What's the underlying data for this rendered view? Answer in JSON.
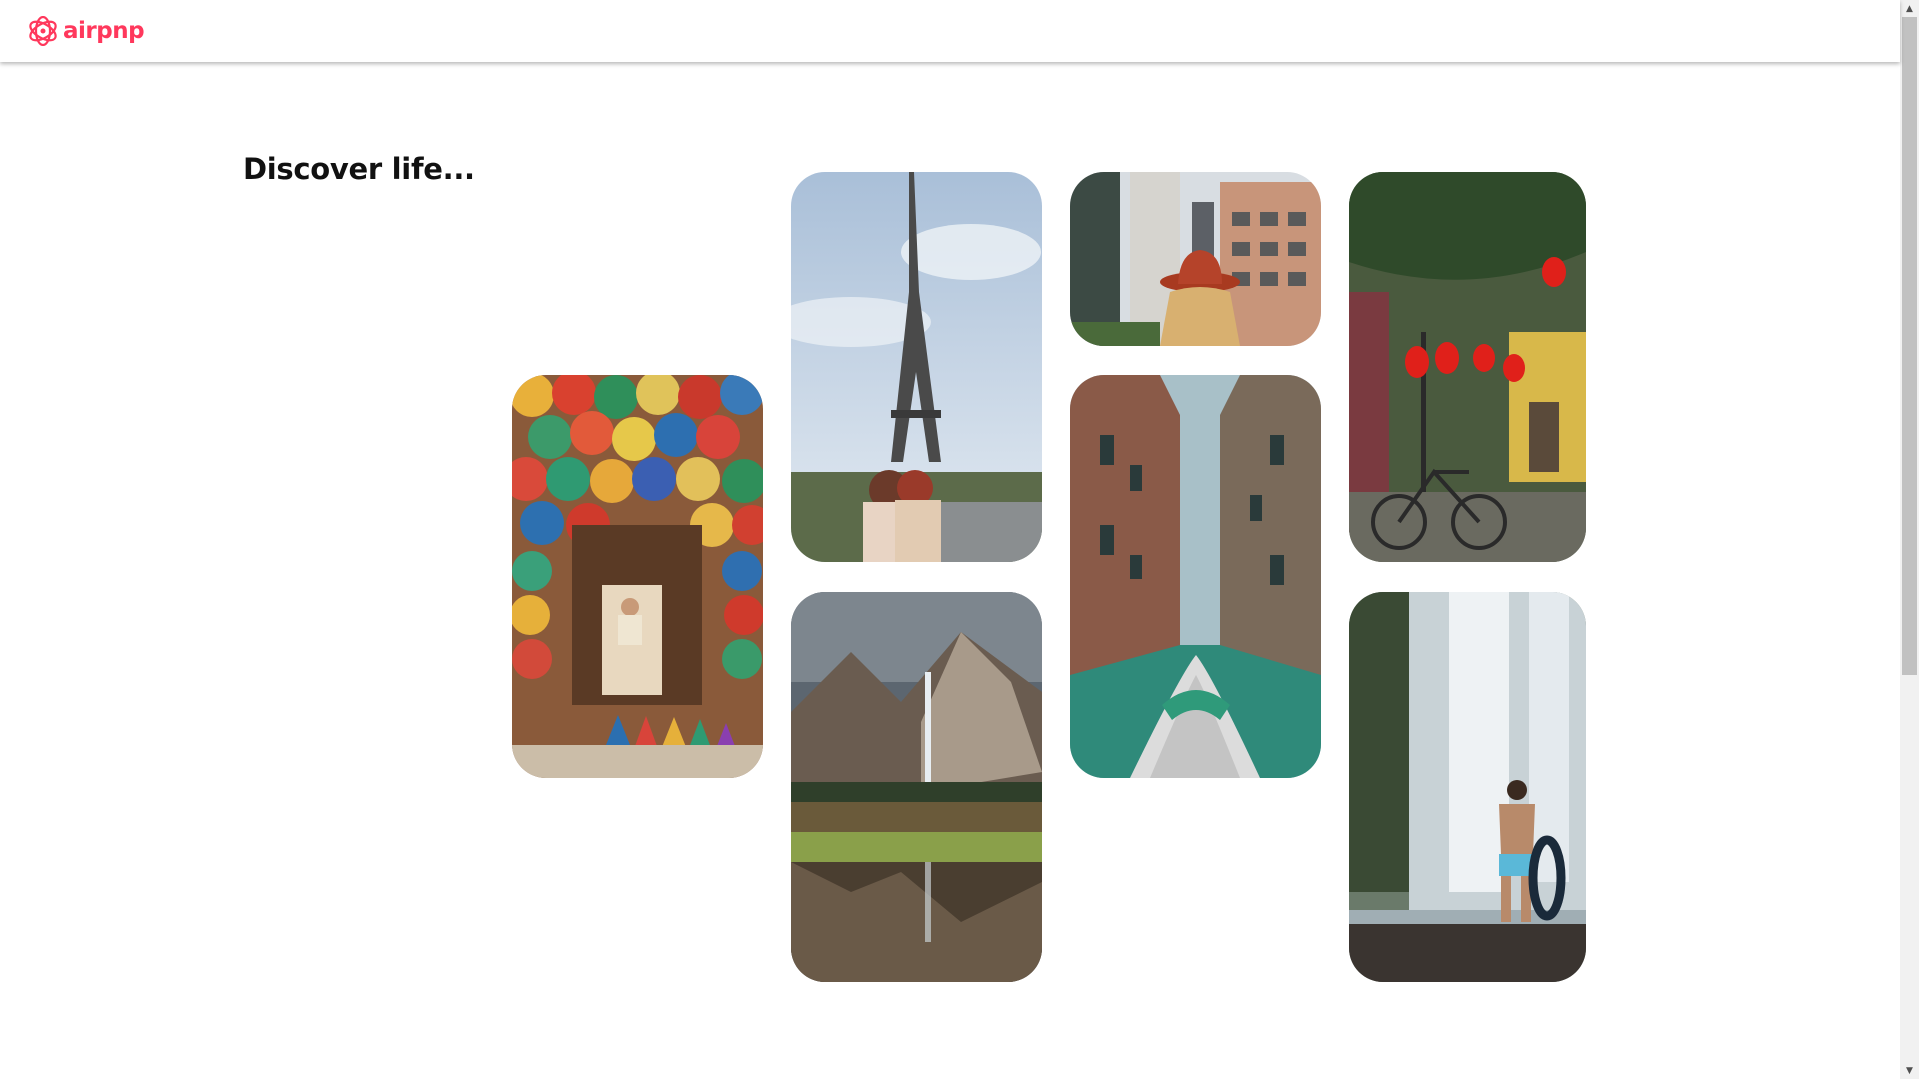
{
  "app": {
    "brand": "airpnp",
    "brand_color": "#ff385c"
  },
  "main": {
    "heading": "Discover life..."
  },
  "gallery": {
    "tiles": [
      {
        "subject": "market-bowls-photo"
      },
      {
        "subject": "eiffel-tower-photo"
      },
      {
        "subject": "mountain-waterfall-photo"
      },
      {
        "subject": "city-red-hat-photo"
      },
      {
        "subject": "venice-canal-photo"
      },
      {
        "subject": "red-lanterns-bicycle-photo"
      },
      {
        "subject": "waterfall-man-photo"
      }
    ]
  }
}
